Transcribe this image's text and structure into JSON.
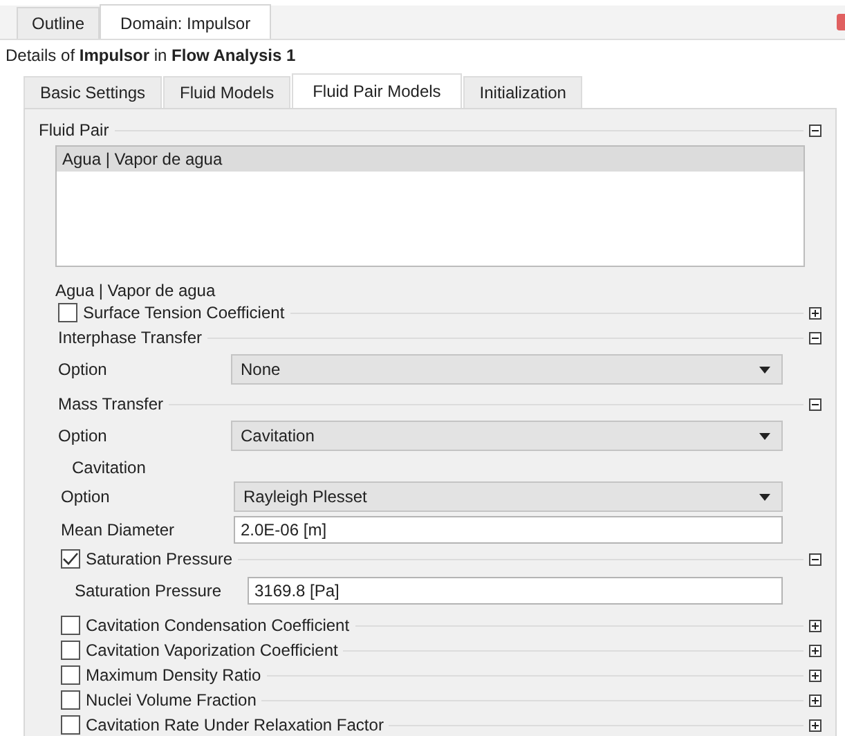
{
  "outer_tabs": [
    {
      "label": "Outline",
      "selected": false
    },
    {
      "label": "Domain: Impulsor",
      "selected": true
    }
  ],
  "details": "Details of **Impulsor** in **Flow Analysis 1**",
  "inner_tabs": [
    {
      "label": "Basic Settings",
      "selected": false
    },
    {
      "label": "Fluid Models",
      "selected": false
    },
    {
      "label": "Fluid Pair Models",
      "selected": true
    },
    {
      "label": "Initialization",
      "selected": false
    }
  ],
  "fluid_pair": {
    "title": "Fluid Pair",
    "expanded": true,
    "list": [
      {
        "label": "Agua | Vapor de agua",
        "selected": true
      }
    ]
  },
  "pair_label": "Agua | Vapor de agua",
  "items": [
    {
      "kind": "check_header",
      "label": "Surface Tension Coefficient",
      "checked": false,
      "expanded": false
    },
    {
      "kind": "header",
      "title": "Interphase Transfer",
      "expanded": true,
      "children": [
        {
          "kind": "dropdown",
          "label": "Option",
          "value": "None"
        }
      ]
    },
    {
      "kind": "header",
      "title": "Mass Transfer",
      "expanded": true,
      "children": [
        {
          "kind": "dropdown",
          "label": "Option",
          "value": "Cavitation"
        },
        {
          "kind": "subgroup",
          "title": "Cavitation",
          "children": [
            {
              "kind": "dropdown",
              "label": "Option",
              "value": "Rayleigh Plesset"
            },
            {
              "kind": "field",
              "label": "Mean Diameter",
              "value": "2.0E-06 [m]"
            },
            {
              "kind": "check_header",
              "label": "Saturation Pressure",
              "checked": true,
              "expanded": true,
              "children": [
                {
                  "kind": "field",
                  "label": "Saturation Pressure",
                  "value": "3169.8 [Pa]"
                }
              ]
            },
            {
              "kind": "check_header",
              "label": "Cavitation Condensation Coefficient",
              "checked": false,
              "expanded": false
            },
            {
              "kind": "check_header",
              "label": "Cavitation Vaporization Coefficient",
              "checked": false,
              "expanded": false
            },
            {
              "kind": "check_header",
              "label": "Maximum Density Ratio",
              "checked": false,
              "expanded": false
            },
            {
              "kind": "check_header",
              "label": "Nuclei Volume Fraction",
              "checked": false,
              "expanded": false
            },
            {
              "kind": "check_header",
              "label": "Cavitation Rate Under Relaxation Factor",
              "checked": false,
              "expanded": false
            }
          ]
        }
      ]
    }
  ]
}
